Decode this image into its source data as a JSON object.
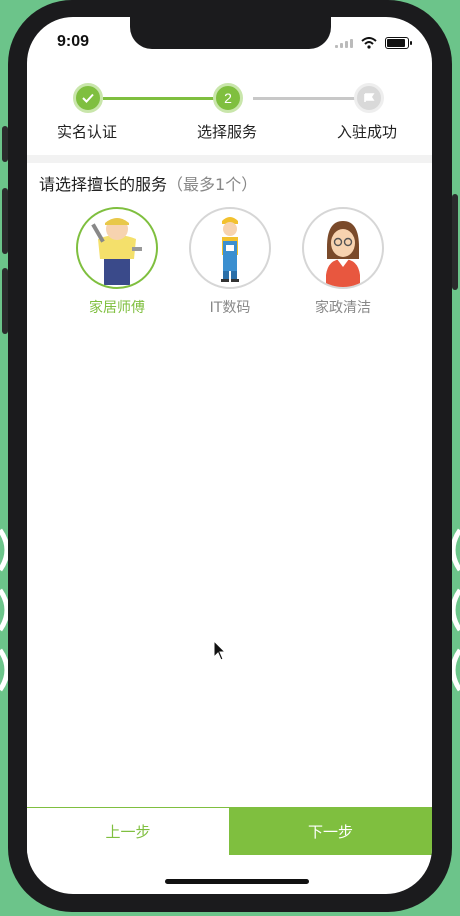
{
  "status": {
    "time": "9:09",
    "icons": [
      "signal-icon",
      "wifi-icon",
      "battery-icon"
    ]
  },
  "stepper": {
    "steps": [
      {
        "label": "实名认证",
        "state": "done",
        "icon": "check-icon"
      },
      {
        "label": "选择服务",
        "state": "current",
        "number": "2"
      },
      {
        "label": "入驻成功",
        "state": "pending",
        "icon": "flag-icon"
      }
    ]
  },
  "prompt": {
    "text": "请选择擅长的服务",
    "hint": "（最多1个）"
  },
  "services": [
    {
      "label": "家居师傅",
      "selected": true,
      "icon": "handyman-icon"
    },
    {
      "label": "IT数码",
      "selected": false,
      "icon": "worker-icon"
    },
    {
      "label": "家政清洁",
      "selected": false,
      "icon": "housekeeper-icon"
    }
  ],
  "footer": {
    "prev_label": "上一步",
    "next_label": "下一步"
  },
  "colors": {
    "accent": "#7fbf3f",
    "background": "#6cc48a",
    "muted": "#888888"
  }
}
